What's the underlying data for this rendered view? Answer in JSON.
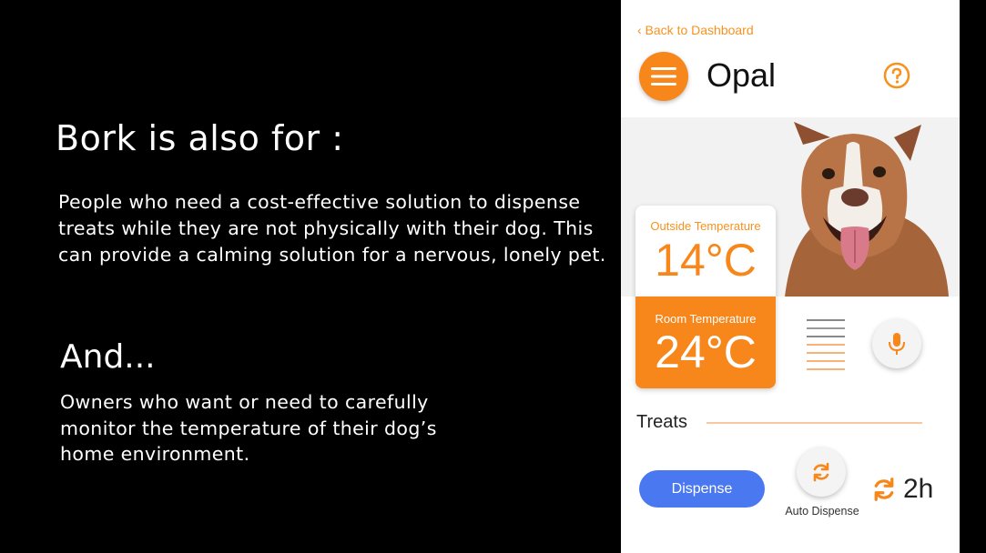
{
  "slide": {
    "heading1": "Bork is also for :",
    "para1": "People who need a cost-effective solution to dispense treats while they are not physically with their dog. This can provide a calming solution for a nervous, lonely pet.",
    "heading2": "And...",
    "para2": "Owners who want or need to carefully monitor the temperature of their dog’s home environment."
  },
  "app": {
    "back_label": "‹ Back to Dashboard",
    "pet_name": "Opal",
    "outside": {
      "label": "Outside Temperature",
      "value": "14°C"
    },
    "room": {
      "label": "Room Temperature",
      "value": "24°C"
    },
    "treats_label": "Treats",
    "dispense_label": "Dispense",
    "auto_dispense_label": "Auto Dispense",
    "interval_value": "2h",
    "colors": {
      "accent": "#f7861b",
      "button_blue": "#4a78f0"
    },
    "icons": [
      "menu-icon",
      "help-icon",
      "dog-photo",
      "mic-icon",
      "refresh-icon",
      "audio-lines-icon"
    ]
  }
}
